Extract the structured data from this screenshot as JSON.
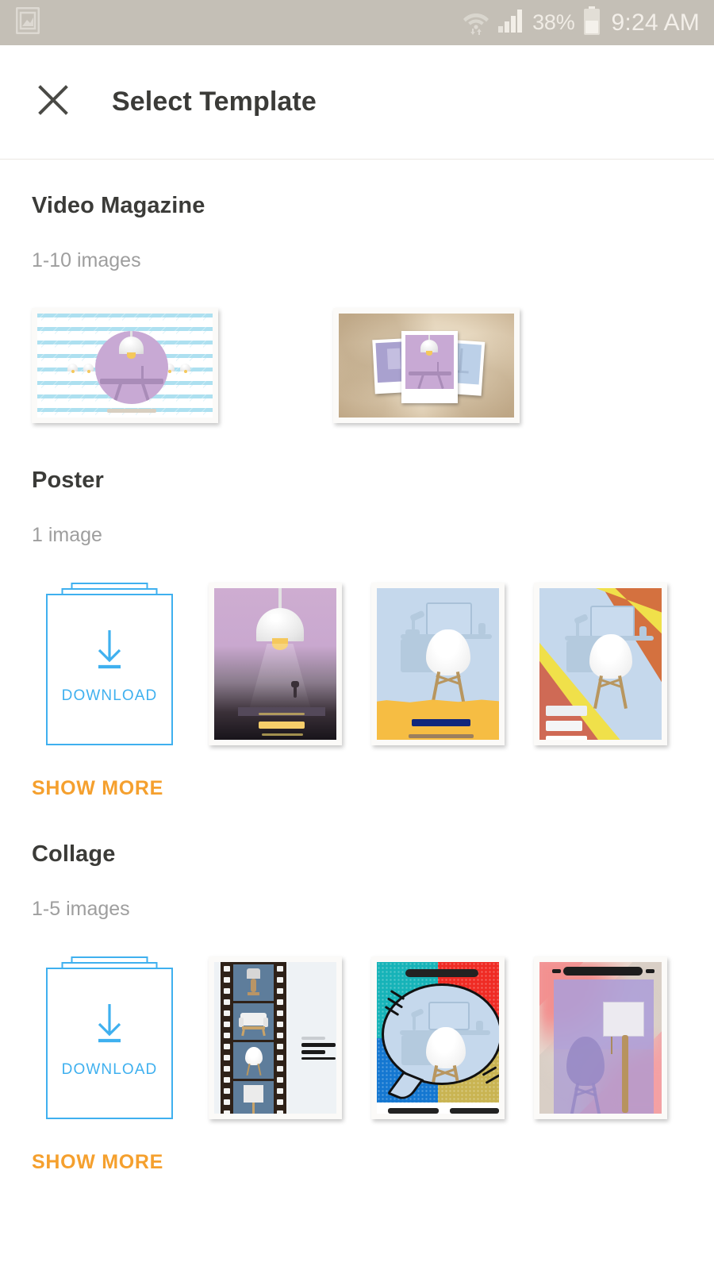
{
  "status_bar": {
    "left_icon": "image-gallery-icon",
    "wifi_icon": "wifi-icon",
    "signal_icon": "cellular-signal-icon",
    "battery_percent": "38%",
    "battery_icon": "battery-icon",
    "clock": "9:24 AM"
  },
  "app_bar": {
    "close_icon": "close-icon",
    "title": "Select Template"
  },
  "colors": {
    "status_bar_bg": "#c4bfb6",
    "accent_orange": "#f5a02e",
    "accent_blue": "#3fb0ef",
    "title_text": "#3b3b38",
    "subtitle_text": "#9e9e9e",
    "page_bg": "#ffffff"
  },
  "sections": [
    {
      "title": "Video Magazine",
      "subtitle": "1-10 images",
      "has_download_card": false,
      "has_show_more": false,
      "thumbnails": [
        {
          "name": "template-chevron-circle",
          "style": "video"
        },
        {
          "name": "template-vintage-polaroid",
          "style": "video"
        }
      ]
    },
    {
      "title": "Poster",
      "subtitle": "1 image",
      "has_download_card": true,
      "download_label": "DOWNLOAD",
      "download_icon": "download-arrow-icon",
      "has_show_more": true,
      "show_more_label": "SHOW MORE",
      "thumbnails": [
        {
          "name": "template-lamp-gradient",
          "style": "poster"
        },
        {
          "name": "template-yellow-chair",
          "style": "poster"
        },
        {
          "name": "template-diagonal-orange",
          "style": "poster"
        }
      ]
    },
    {
      "title": "Collage",
      "subtitle": "1-5 images",
      "has_download_card": true,
      "download_label": "DOWNLOAD",
      "download_icon": "download-arrow-icon",
      "has_show_more": true,
      "show_more_label": "SHOW MORE",
      "thumbnails": [
        {
          "name": "template-filmstrip",
          "style": "collage"
        },
        {
          "name": "template-comic-bubble",
          "style": "collage"
        },
        {
          "name": "template-lavender-overlay",
          "style": "collage"
        }
      ]
    }
  ]
}
